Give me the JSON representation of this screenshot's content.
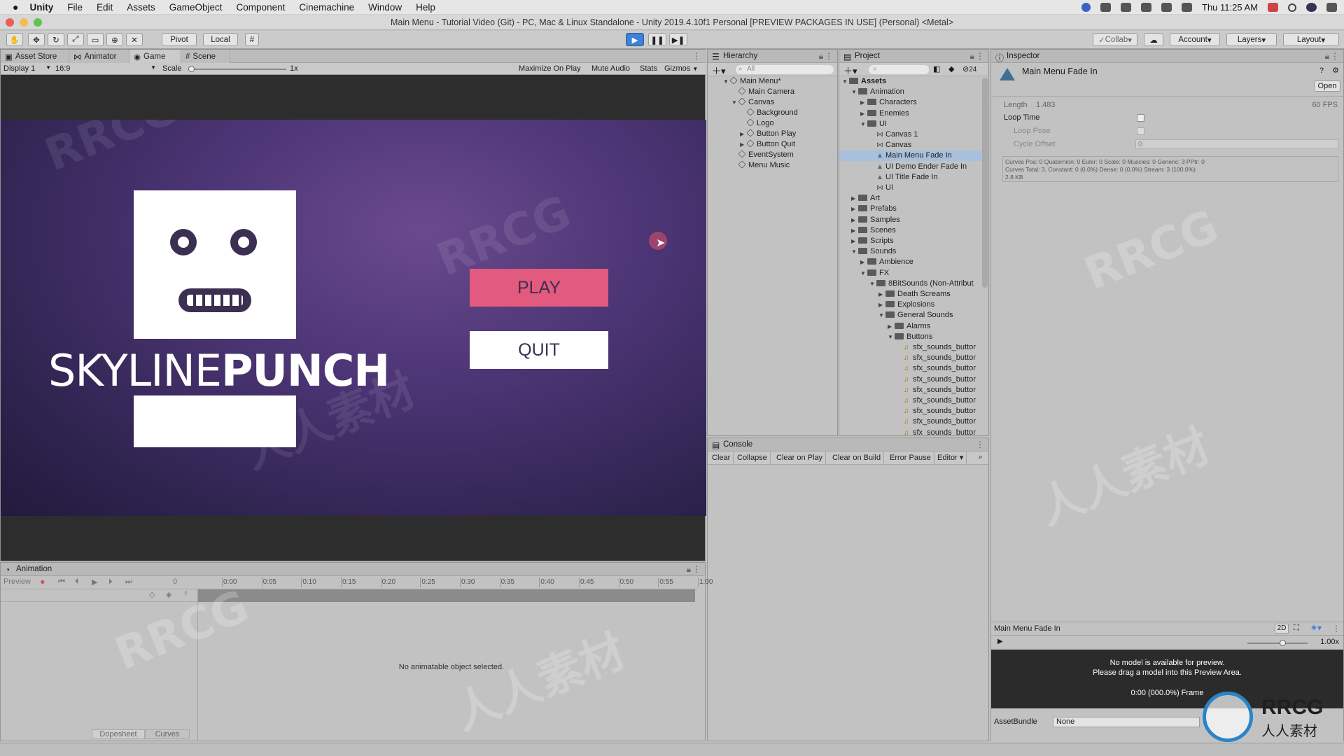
{
  "menubar": {
    "app": "Unity",
    "items": [
      "File",
      "Edit",
      "Assets",
      "GameObject",
      "Component",
      "Cinemachine",
      "Window",
      "Help"
    ],
    "clock": "Thu 11:25 AM"
  },
  "window_title": "Main Menu - Tutorial Video (Git) - PC, Mac & Linux Standalone - Unity 2019.4.10f1 Personal [PREVIEW PACKAGES IN USE] (Personal) <Metal>",
  "toolbar": {
    "pivot": "Pivot",
    "local": "Local",
    "collab": "Collab",
    "account": "Account",
    "layers": "Layers",
    "layout": "Layout"
  },
  "game_panel": {
    "tabs": [
      "Asset Store",
      "Animator",
      "Game",
      "Scene"
    ],
    "display": "Display 1",
    "aspect": "16:9",
    "scale_label": "Scale",
    "scale_value": "1x",
    "options": [
      "Maximize On Play",
      "Mute Audio",
      "Stats",
      "Gizmos"
    ]
  },
  "game_view": {
    "logo_light": "SKYLINE",
    "logo_bold": "PUNCH",
    "play": "PLAY",
    "quit": "QUIT"
  },
  "hierarchy": {
    "title": "Hierarchy",
    "search_placeholder": "All",
    "items": [
      {
        "label": "Main Menu*",
        "depth": 0,
        "arrow": "▼"
      },
      {
        "label": "Main Camera",
        "depth": 1,
        "arrow": ""
      },
      {
        "label": "Canvas",
        "depth": 1,
        "arrow": "▼"
      },
      {
        "label": "Background",
        "depth": 2,
        "arrow": ""
      },
      {
        "label": "Logo",
        "depth": 2,
        "arrow": ""
      },
      {
        "label": "Button Play",
        "depth": 2,
        "arrow": "▶"
      },
      {
        "label": "Button Quit",
        "depth": 2,
        "arrow": "▶"
      },
      {
        "label": "EventSystem",
        "depth": 1,
        "arrow": ""
      },
      {
        "label": "Menu Music",
        "depth": 1,
        "arrow": ""
      }
    ]
  },
  "project": {
    "title": "Project",
    "count": "24",
    "items": [
      {
        "label": "Assets",
        "depth": 0,
        "arrow": "▼",
        "kind": "folder",
        "bold": true
      },
      {
        "label": "Animation",
        "depth": 1,
        "arrow": "▼",
        "kind": "folder"
      },
      {
        "label": "Characters",
        "depth": 2,
        "arrow": "▶",
        "kind": "folder"
      },
      {
        "label": "Enemies",
        "depth": 2,
        "arrow": "▶",
        "kind": "folder"
      },
      {
        "label": "UI",
        "depth": 2,
        "arrow": "▼",
        "kind": "folder"
      },
      {
        "label": "Canvas 1",
        "depth": 3,
        "arrow": "",
        "kind": "anim"
      },
      {
        "label": "Canvas",
        "depth": 3,
        "arrow": "",
        "kind": "anim"
      },
      {
        "label": "Main Menu Fade In",
        "depth": 3,
        "arrow": "",
        "kind": "clip",
        "selected": true
      },
      {
        "label": "UI Demo Ender Fade In",
        "depth": 3,
        "arrow": "",
        "kind": "clip"
      },
      {
        "label": "UI Title Fade In",
        "depth": 3,
        "arrow": "",
        "kind": "clip"
      },
      {
        "label": "UI",
        "depth": 3,
        "arrow": "",
        "kind": "anim"
      },
      {
        "label": "Art",
        "depth": 1,
        "arrow": "▶",
        "kind": "folder"
      },
      {
        "label": "Prefabs",
        "depth": 1,
        "arrow": "▶",
        "kind": "folder"
      },
      {
        "label": "Samples",
        "depth": 1,
        "arrow": "▶",
        "kind": "folder"
      },
      {
        "label": "Scenes",
        "depth": 1,
        "arrow": "▶",
        "kind": "folder"
      },
      {
        "label": "Scripts",
        "depth": 1,
        "arrow": "▶",
        "kind": "folder"
      },
      {
        "label": "Sounds",
        "depth": 1,
        "arrow": "▼",
        "kind": "folder"
      },
      {
        "label": "Ambience",
        "depth": 2,
        "arrow": "▶",
        "kind": "folder"
      },
      {
        "label": "FX",
        "depth": 2,
        "arrow": "▼",
        "kind": "folder"
      },
      {
        "label": "8BitSounds (Non-Attribut",
        "depth": 3,
        "arrow": "▼",
        "kind": "folder"
      },
      {
        "label": "Death Screams",
        "depth": 4,
        "arrow": "▶",
        "kind": "folder"
      },
      {
        "label": "Explosions",
        "depth": 4,
        "arrow": "▶",
        "kind": "folder"
      },
      {
        "label": "General Sounds",
        "depth": 4,
        "arrow": "▼",
        "kind": "folder"
      },
      {
        "label": "Alarms",
        "depth": 5,
        "arrow": "▶",
        "kind": "folder"
      },
      {
        "label": "Buttons",
        "depth": 5,
        "arrow": "▼",
        "kind": "folder"
      },
      {
        "label": "sfx_sounds_buttor",
        "depth": 6,
        "arrow": "",
        "kind": "sound"
      },
      {
        "label": "sfx_sounds_buttor",
        "depth": 6,
        "arrow": "",
        "kind": "sound"
      },
      {
        "label": "sfx_sounds_buttor",
        "depth": 6,
        "arrow": "",
        "kind": "sound"
      },
      {
        "label": "sfx_sounds_buttor",
        "depth": 6,
        "arrow": "",
        "kind": "sound"
      },
      {
        "label": "sfx_sounds_buttor",
        "depth": 6,
        "arrow": "",
        "kind": "sound"
      },
      {
        "label": "sfx_sounds_buttor",
        "depth": 6,
        "arrow": "",
        "kind": "sound"
      },
      {
        "label": "sfx_sounds_buttor",
        "depth": 6,
        "arrow": "",
        "kind": "sound"
      },
      {
        "label": "sfx_sounds_buttor",
        "depth": 6,
        "arrow": "",
        "kind": "sound"
      },
      {
        "label": "sfx_sounds_buttor",
        "depth": 6,
        "arrow": "",
        "kind": "sound"
      }
    ]
  },
  "console": {
    "title": "Console",
    "buttons": [
      "Clear",
      "Collapse",
      "Clear on Play",
      "Clear on Build",
      "Error Pause",
      "Editor ▾"
    ]
  },
  "inspector": {
    "title": "Inspector",
    "asset_name": "Main Menu Fade In",
    "open": "Open",
    "length_label": "Length",
    "length_value": "1.483",
    "fps": "60 FPS",
    "loop_time": "Loop Time",
    "loop_pose": "Loop Pose",
    "cycle_offset": "Cycle Offset",
    "cycle_offset_value": "0",
    "info_line1": "Curves Pos: 0 Quaternion: 0 Euler: 0 Scale: 0 Muscles: 0 Generic: 3 PPtr: 0",
    "info_line2": "Curves Total: 3, Constant: 0 (0.0%) Dense: 0 (0.0%) Stream: 3 (100.0%)",
    "info_line3": "2.8 KB",
    "preview_title": "Main Menu Fade In",
    "preview_2d": "2D",
    "preview_speed": "1.00x",
    "no_model_1": "No model is available for preview.",
    "no_model_2": "Please drag a model into this Preview Area.",
    "frame": "0:00 (000.0%) Frame",
    "assetbundle_label": "AssetBundle",
    "assetbundle_value": "None"
  },
  "animation": {
    "title": "Animation",
    "preview": "Preview",
    "frame": "0",
    "ticks": [
      "0:00",
      "0:05",
      "0:10",
      "0:15",
      "0:20",
      "0:25",
      "0:30",
      "0:35",
      "0:40",
      "0:45",
      "0:50",
      "0:55",
      "1:00"
    ],
    "empty": "No animatable object selected.",
    "dopesheet": "Dopesheet",
    "curves": "Curves"
  },
  "watermark": [
    "RRCG",
    "人人素材"
  ],
  "colors": {
    "play_button": "#e25a7d",
    "play_tool": "#3d82d6",
    "selection": "#a9c0dd"
  }
}
